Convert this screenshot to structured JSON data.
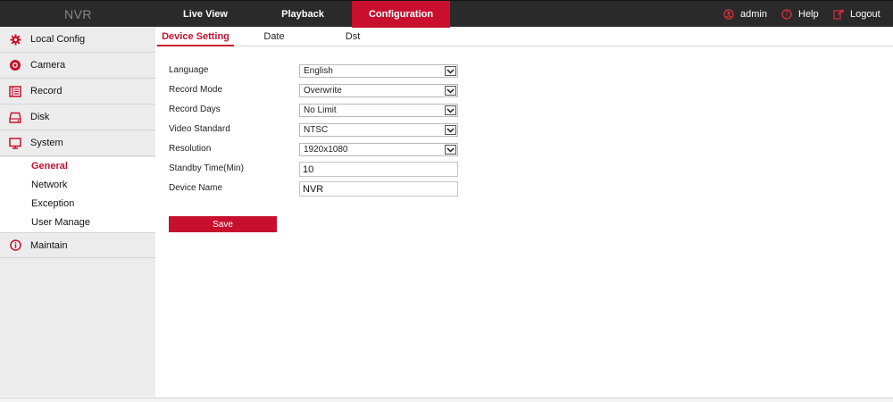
{
  "app": {
    "brand": "NVR"
  },
  "topnav": [
    {
      "label": "Live View"
    },
    {
      "label": "Playback"
    },
    {
      "label": "Configuration"
    }
  ],
  "topnav_active": "Configuration",
  "user_bar": {
    "user": "admin",
    "help": "Help",
    "logout": "Logout"
  },
  "sidebar": {
    "items": [
      {
        "label": "Local Config",
        "icon": "gear-icon"
      },
      {
        "label": "Camera",
        "icon": "camera-icon"
      },
      {
        "label": "Record",
        "icon": "record-icon"
      },
      {
        "label": "Disk",
        "icon": "disk-icon"
      },
      {
        "label": "System",
        "icon": "monitor-icon"
      },
      {
        "label": "Maintain",
        "icon": "info-icon"
      }
    ],
    "system_sub": [
      {
        "label": "General"
      },
      {
        "label": "Network"
      },
      {
        "label": "Exception"
      },
      {
        "label": "User Manage"
      }
    ],
    "active_sub": "General"
  },
  "tabs": [
    {
      "label": "Device Setting"
    },
    {
      "label": "Date"
    },
    {
      "label": "Dst"
    }
  ],
  "active_tab": "Device Setting",
  "form": {
    "language": {
      "label": "Language",
      "value": "English"
    },
    "record_mode": {
      "label": "Record Mode",
      "value": "Overwrite"
    },
    "record_days": {
      "label": "Record Days",
      "value": "No Limit"
    },
    "video_standard": {
      "label": "Video Standard",
      "value": "NTSC"
    },
    "resolution": {
      "label": "Resolution",
      "value": "1920x1080"
    },
    "standby_time": {
      "label": "Standby Time(Min)",
      "value": "10"
    },
    "device_name": {
      "label": "Device Name",
      "value": "NVR"
    }
  },
  "save_label": "Save",
  "colors": {
    "accent": "#c8102e",
    "topbar": "#2a2a2a",
    "sidebar": "#ececec"
  }
}
